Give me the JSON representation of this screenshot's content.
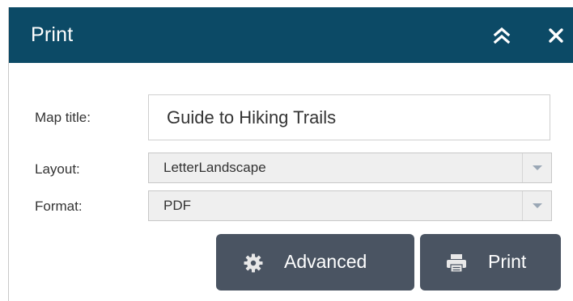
{
  "panel": {
    "title": "Print",
    "collapse_icon": "double-chevron-up-icon",
    "close_icon": "close-icon",
    "header_color": "#0c4a66"
  },
  "form": {
    "map_title_label": "Map title:",
    "map_title_value": "Guide to Hiking Trails",
    "layout_label": "Layout:",
    "layout_value": "LetterLandscape",
    "format_label": "Format:",
    "format_value": "PDF"
  },
  "actions": {
    "advanced_label": "Advanced",
    "advanced_icon": "gear-icon",
    "print_label": "Print",
    "print_icon": "printer-icon",
    "button_color": "#4a5462"
  }
}
